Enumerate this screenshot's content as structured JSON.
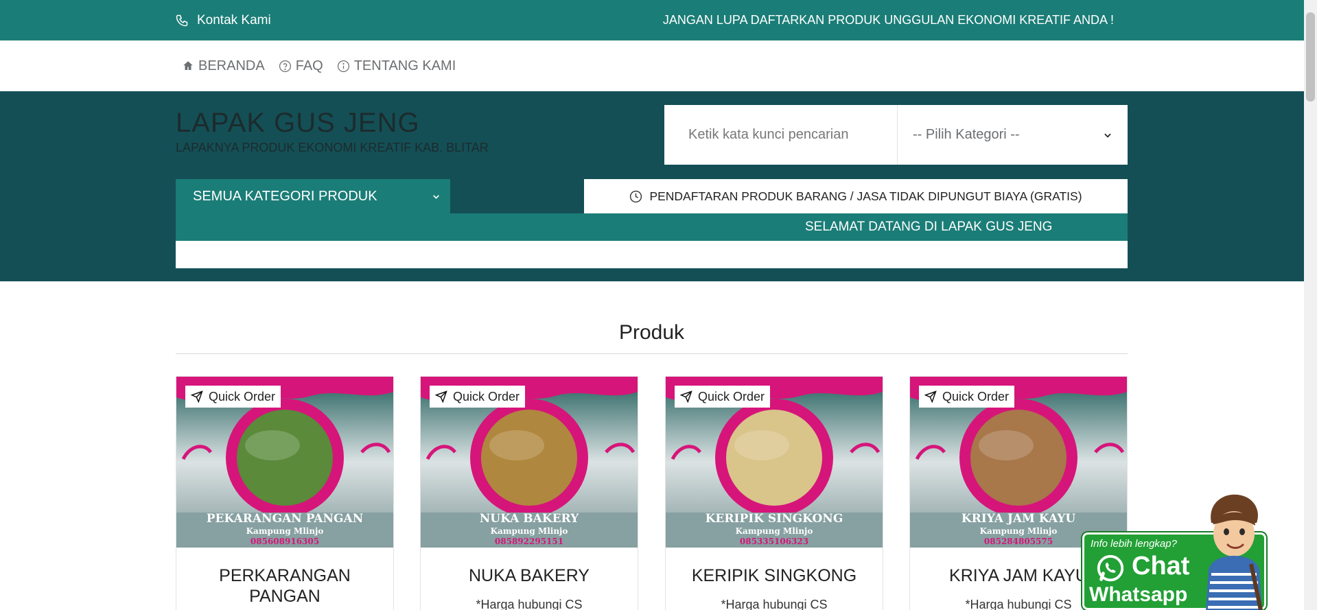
{
  "topbar": {
    "contact_label": "Kontak Kami",
    "notice": "JANGAN LUPA DAFTARKAN PRODUK UNGGULAN EKONOMI KREATIF ANDA !"
  },
  "nav": {
    "items": [
      {
        "label": "BERANDA",
        "icon": "home-icon"
      },
      {
        "label": "FAQ",
        "icon": "question-circle-icon"
      },
      {
        "label": "TENTANG KAMI",
        "icon": "info-circle-icon"
      }
    ]
  },
  "hero": {
    "title": "LAPAK GUS JENG",
    "subtitle": "LAPAKNYA PRODUK EKONOMI KREATIF KAB. BLITAR",
    "search_placeholder": "Ketik kata kunci pencarian",
    "category_select": "-- Pilih Kategori --",
    "all_categories": "SEMUA KATEGORI PRODUK",
    "free_notice": "PENDAFTARAN PRODUK BARANG / JASA TIDAK DIPUNGUT BIAYA (GRATIS)",
    "welcome": "SELAMAT DATANG DI LAPAK GUS JENG"
  },
  "produk": {
    "title": "Produk",
    "quick_order": "Quick Order",
    "cards": [
      {
        "name": "PERKARANGAN PANGAN",
        "price": "*Harga hubungi CS",
        "banner_name": "PEKARANGAN PANGAN",
        "banner_sub": "Kampung Mlinjo",
        "banner_phone": "085608916305",
        "photo_color": "#5a8a3a"
      },
      {
        "name": "NUKA BAKERY",
        "price": "*Harga hubungi CS",
        "banner_name": "NUKA BAKERY",
        "banner_sub": "Kampung Mlinjo",
        "banner_phone": "085892295151",
        "photo_color": "#b0873e"
      },
      {
        "name": "KERIPIK SINGKONG",
        "price": "*Harga hubungi CS",
        "banner_name": "KERIPIK SINGKONG",
        "banner_sub": "Kampung Mlinjo",
        "banner_phone": "085335106323",
        "photo_color": "#d9c48a"
      },
      {
        "name": "KRIYA JAM KAYU",
        "price": "*Harga hubungi CS",
        "banner_name": "KRIYA JAM KAYU",
        "banner_sub": "Kampung Mlinjo",
        "banner_phone": "085284805575",
        "photo_color": "#a8774a"
      }
    ]
  },
  "whatsapp_widget": {
    "info": "Info lebih lengkap?",
    "chat": "Chat",
    "app": "Whatsapp"
  },
  "colors": {
    "primary": "#1b7d77",
    "hero_bg": "#144f56",
    "banner_pink": "#d6157a",
    "whatsapp_green": "#22a035"
  }
}
